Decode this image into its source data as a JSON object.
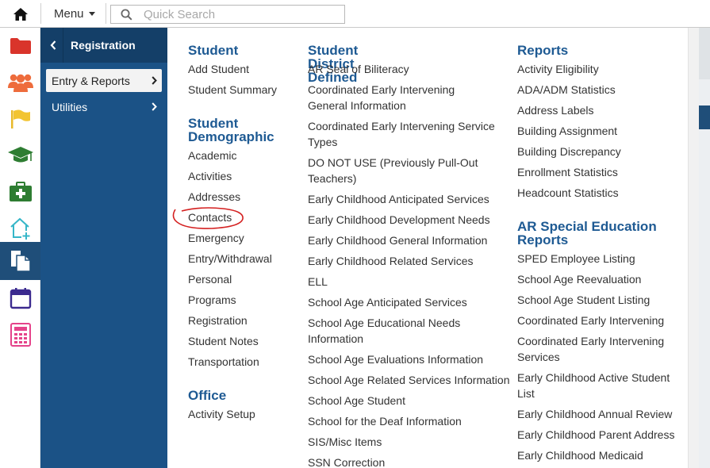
{
  "topbar": {
    "menu_label": "Menu",
    "search_placeholder": "Quick Search",
    "search_value": ""
  },
  "rail": {
    "items": [
      {
        "icon": "folder-icon",
        "color": "#d9342b"
      },
      {
        "icon": "users-icon",
        "color": "#ee6c3c"
      },
      {
        "icon": "flag-icon",
        "color": "#f2c432"
      },
      {
        "icon": "graduation-cap-icon",
        "color": "#2e7d32"
      },
      {
        "icon": "medical-kit-icon",
        "color": "#2e7d32"
      },
      {
        "icon": "house-plus-icon",
        "color": "#35b6c8"
      },
      {
        "icon": "documents-icon",
        "color": "#ffffff"
      },
      {
        "icon": "calendar-icon",
        "color": "#3b2a8f"
      },
      {
        "icon": "calculator-icon",
        "color": "#e5438a"
      }
    ]
  },
  "nav": {
    "header": "Registration",
    "items": [
      {
        "label": "Entry & Reports",
        "selected": true
      },
      {
        "label": "Utilities",
        "selected": false
      }
    ]
  },
  "content": {
    "col1": {
      "sections": [
        {
          "title": "Student",
          "items": [
            "Add Student",
            "Student Summary"
          ]
        },
        {
          "title": "Student Demographic",
          "items": [
            "Academic",
            "Activities",
            "Addresses",
            "Contacts",
            "Emergency",
            "Entry/Withdrawal",
            "Personal",
            "Programs",
            "Registration",
            "Student Notes",
            "Transportation"
          ]
        },
        {
          "title": "Office",
          "items": [
            "Activity Setup"
          ]
        }
      ]
    },
    "col2": {
      "sections": [
        {
          "title": "Student District Defined",
          "items": [
            "AR Seal of Biliteracy",
            "Coordinated Early Intervening General Information",
            "Coordinated Early Intervening Service Types",
            "DO NOT USE (Previously Pull-Out Teachers)",
            "Early Childhood Anticipated Services",
            "Early Childhood Development Needs",
            "Early Childhood General Information",
            "Early Childhood Related Services",
            "ELL",
            "School Age Anticipated Services",
            "School Age Educational Needs Information",
            "School Age Evaluations Information",
            "School Age Related Services Information",
            "School Age Student",
            "School for the Deaf Information",
            "SIS/Misc Items",
            "SSN Correction"
          ]
        }
      ]
    },
    "col3": {
      "sections": [
        {
          "title": "Reports",
          "items": [
            "Activity Eligibility",
            "ADA/ADM Statistics",
            "Address Labels",
            "Building Assignment",
            "Building Discrepancy",
            "Enrollment Statistics",
            "Headcount Statistics"
          ]
        },
        {
          "title": "AR Special Education Reports",
          "items": [
            "SPED Employee Listing",
            "School Age Reevaluation",
            "School Age Student Listing",
            "Coordinated Early Intervening",
            "Coordinated Early Intervening Services",
            "Early Childhood Active Student List",
            "Early Childhood Annual Review",
            "Early Childhood Parent Address",
            "Early Childhood Medicaid"
          ]
        }
      ]
    }
  },
  "colors": {
    "nav_bg": "#1b5286",
    "nav_header_bg": "#143f68",
    "section_title": "#1e5a93",
    "annotation": "#d42020"
  }
}
